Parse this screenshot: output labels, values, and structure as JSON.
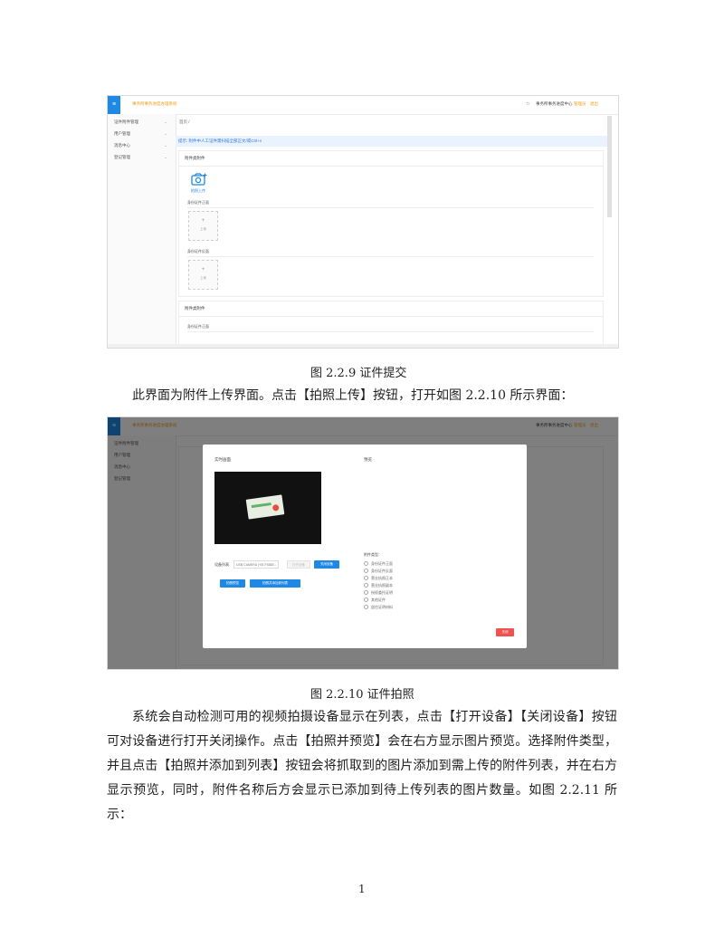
{
  "shot1": {
    "system_title": "事务所事务进度办理系统",
    "top_right": {
      "icon": "bell-icon",
      "link": "事务所事务进度中心",
      "user": "管理员",
      "logout": "退出"
    },
    "sidebar": [
      {
        "label": "证件附件管理"
      },
      {
        "label": "用户管理"
      },
      {
        "label": "消息中心"
      },
      {
        "label": "登记管理"
      }
    ],
    "breadcrumb": "首页 /",
    "tip": "提示: 附件中人工证件需扫描全部正文/或Ctrl+v",
    "card_title": "附件类附件",
    "camera_label": "拍照上传",
    "section1": "身份证件正面",
    "section2": "身份证件反面",
    "upload_plus": "+",
    "upload_text": "上传",
    "lower_card_title": "附件类附件",
    "lower_section": "身份证件正面"
  },
  "caption1": "图 2.2.9  证件提交",
  "para1": "此界面为附件上传界面。点击【拍照上传】按钮，打开如图 2.2.10 所示界面：",
  "shot2": {
    "modal_left_title": "实时画面",
    "modal_right_title": "预览",
    "device_label": "设备列表",
    "device_value": "USB CAMERA (YM-FS880...",
    "open_device": "打开设备",
    "close_device": "关闭设备",
    "capture_preview": "拍照预览",
    "capture_add": "拍照并添加到列表",
    "type_label": "附件类型：",
    "types": [
      "身份证件正面",
      "身份证件反面",
      "营业执照正本",
      "营业执照副本",
      "授权委托证明",
      "其他证件",
      "居住证明材料"
    ],
    "close": "关闭"
  },
  "caption2": "图 2.2.10  证件拍照",
  "para2": "系统会自动检测可用的视频拍摄设备显示在列表，点击【打开设备】【关闭设备】按钮可对设备进行打开关闭操作。点击【拍照并预览】会在右方显示图片预览。选择附件类型，并且点击【拍照并添加到列表】按钮会将抓取到的图片添加到需上传的附件列表，并在右方显示预览，同时，附件名称后方会显示已添加到待上传列表的图片数量。如图 2.2.11 所示：",
  "page_number": "1"
}
